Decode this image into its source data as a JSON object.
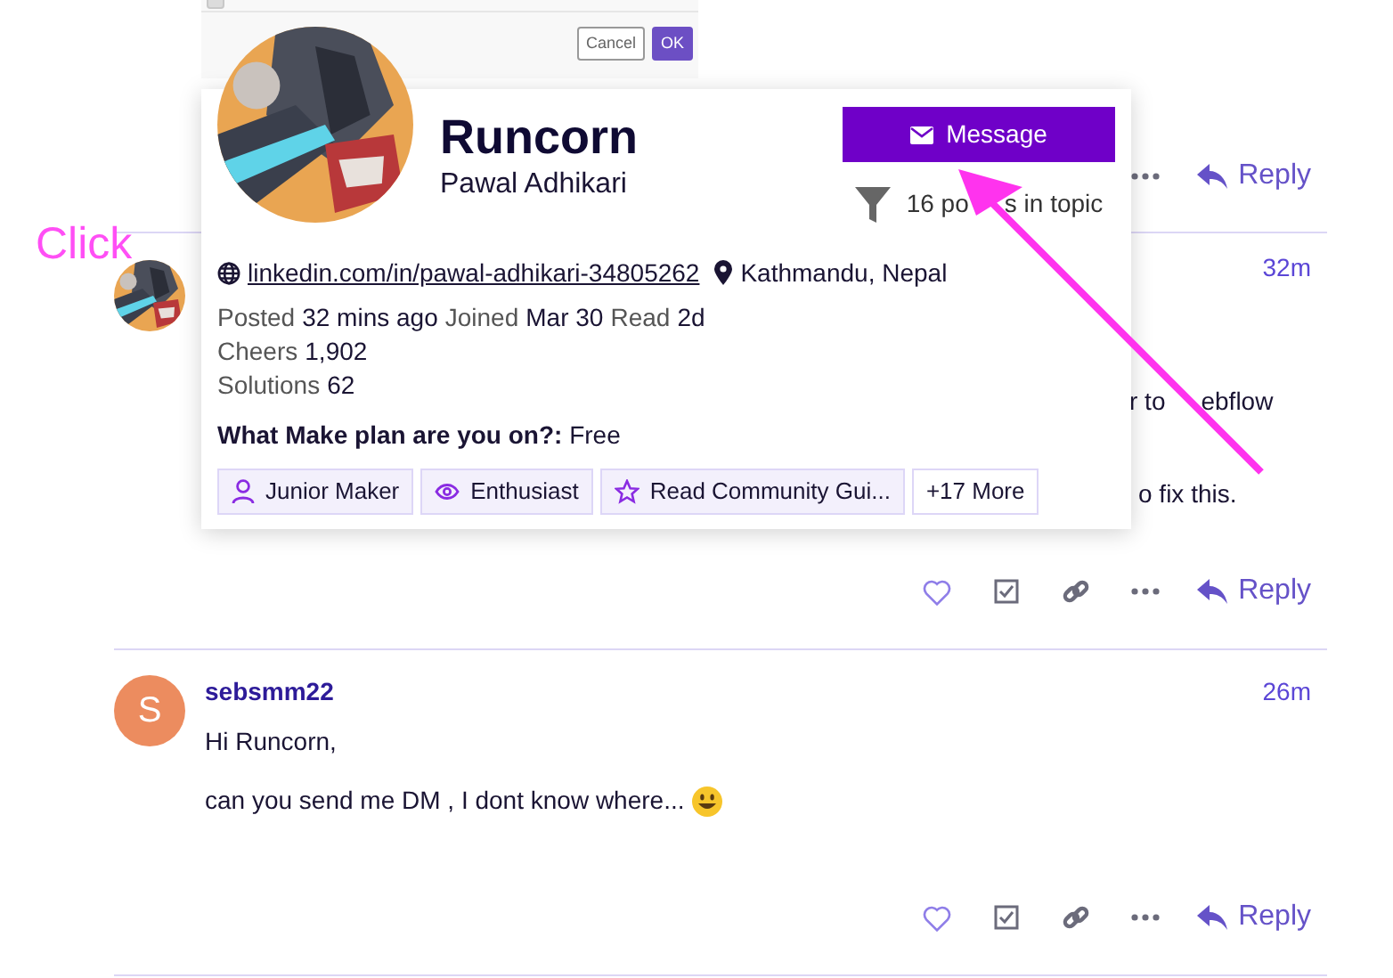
{
  "dialog": {
    "checked": false,
    "buttons": [
      {
        "label": "Cancel",
        "kind": "secondary"
      },
      {
        "label": "OK",
        "kind": "primary"
      }
    ]
  },
  "previous_post": {
    "reply": "Reply"
  },
  "posts": [
    {
      "avatar": {
        "kind": "picture"
      },
      "time": "32m",
      "body": [
        [
          "r to",
          "ebflow"
        ],
        [
          "o fix this."
        ]
      ],
      "reply": "Reply"
    },
    {
      "avatar": {
        "kind": "letter",
        "letter": "S",
        "color": "#ec8c5f"
      },
      "username": "sebsmm22",
      "time": "26m",
      "body": [
        "Hi Runcorn,",
        "can you send me DM , I dont know where..."
      ],
      "emoji": true,
      "reply": "Reply"
    }
  ],
  "user_card": {
    "username": "Runcorn",
    "name": "Pawal Adhikari",
    "message_button": "Message",
    "topic_posts": [
      "16 po",
      "s in topic"
    ],
    "website": "linkedin.com/in/pawal-adhikari-34805262",
    "location": "Kathmandu, Nepal",
    "stat_lines": [
      [
        {
          "label": "Posted",
          "value": "32 mins ago"
        },
        {
          "label": "Joined",
          "value": "Mar 30"
        },
        {
          "label": "Read",
          "value": "2d"
        }
      ],
      [
        {
          "label": "Cheers",
          "value": "1,902"
        }
      ],
      [
        {
          "label": "Solutions",
          "value": "62"
        }
      ]
    ],
    "custom_field": "**What Make plan are you on?:** Free",
    "badges": [
      {
        "label": "Junior Maker",
        "kind": "user"
      },
      {
        "label": "Enthusiast",
        "kind": "eye"
      },
      {
        "label": "Read Community Gui...",
        "kind": "star"
      }
    ],
    "more_badges": "+17 More"
  },
  "annotation": {
    "label": "Click"
  }
}
